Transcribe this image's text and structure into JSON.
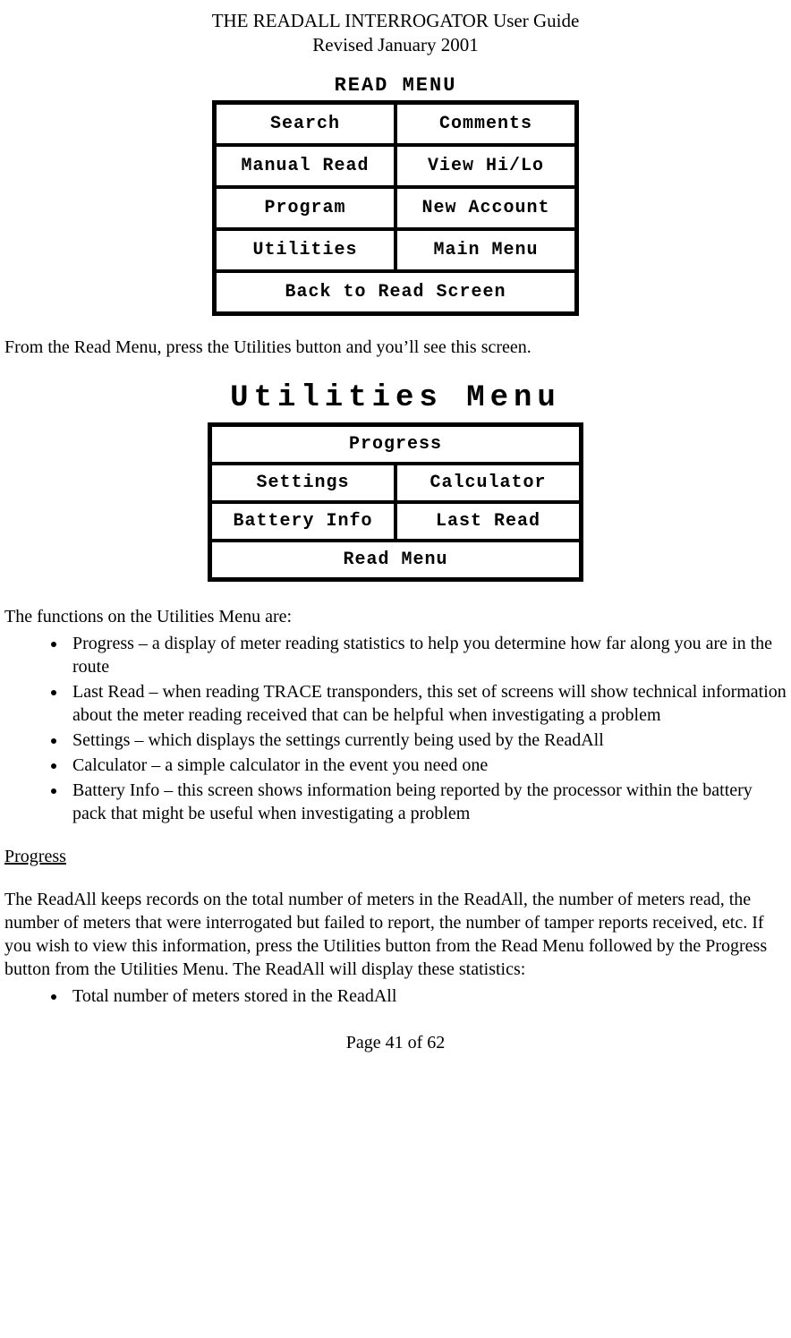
{
  "header": {
    "title": "THE READALL INTERROGATOR User Guide",
    "revised": "Revised January 2001"
  },
  "read_menu": {
    "title": "READ MENU",
    "cells": [
      "Search",
      "Comments",
      "Manual Read",
      "View Hi/Lo",
      "Program",
      "New Account",
      "Utilities",
      "Main Menu"
    ],
    "wide": "Back to Read Screen"
  },
  "para1": "From the Read Menu, press the Utilities button and you’ll see this screen.",
  "util_menu": {
    "title": "Utilities Menu",
    "top_wide": "Progress",
    "cells": [
      "Settings",
      "Calculator",
      "Battery Info",
      "Last Read"
    ],
    "bottom_wide": "Read Menu"
  },
  "para2": "The functions on the Utilities Menu are:",
  "functions": [
    "Progress – a display of meter reading statistics to help you determine how far along you are in the route",
    "Last Read – when reading TRACE transponders, this set of screens will show technical information about the meter reading received that can be helpful when investigating a problem",
    "Settings – which displays the settings currently being used by the ReadAll",
    "Calculator – a simple calculator in the event you need one",
    "Battery Info – this screen shows information being reported by the processor within the battery pack that might be useful when investigating a problem"
  ],
  "section_heading": "Progress",
  "para3": "The ReadAll keeps records on the total number of meters in the ReadAll, the number of meters read, the number of meters that were interrogated but failed to report, the number of tamper reports received, etc.  If you wish to view this information, press the Utilities button from the Read Menu followed by the Progress button from the Utilities Menu.  The ReadAll will display these statistics:",
  "stats": [
    "Total number of meters stored in the ReadAll"
  ],
  "footer": "Page 41 of 62"
}
